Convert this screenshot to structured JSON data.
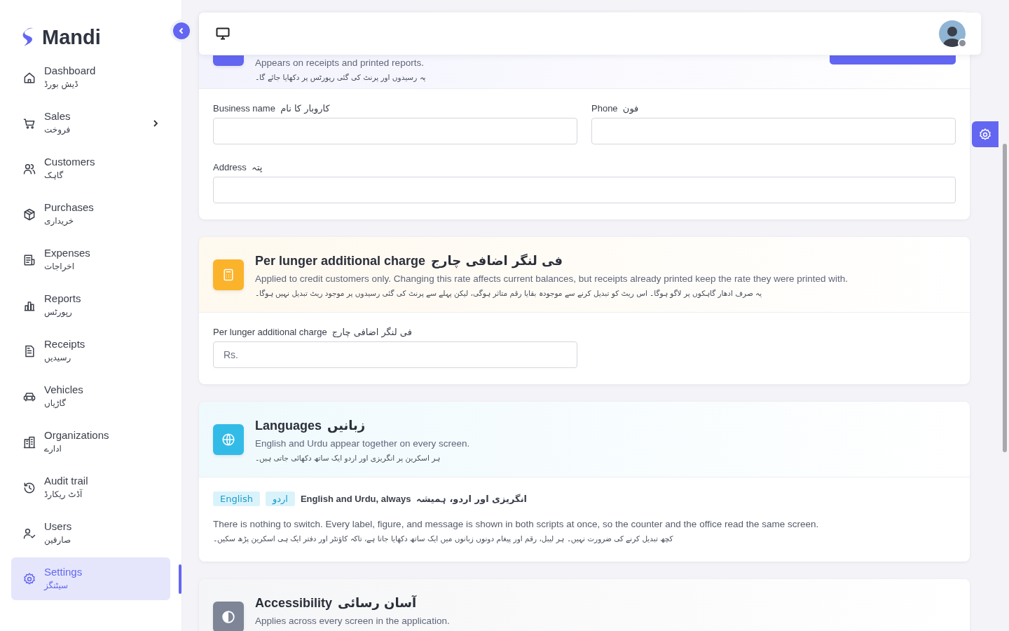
{
  "sidebar": {
    "logo": "Mandi",
    "items": [
      {
        "label": "Dashboard",
        "label_ur": "ڈیش بورڈ",
        "selected": false,
        "has_submenu": false
      },
      {
        "label": "Sales",
        "label_ur": "فروخت",
        "selected": false,
        "has_submenu": true
      },
      {
        "label": "Customers",
        "label_ur": "گاہک",
        "selected": false,
        "has_submenu": false
      },
      {
        "label": "Purchases",
        "label_ur": "خریداری",
        "selected": false,
        "has_submenu": false
      },
      {
        "label": "Expenses",
        "label_ur": "اخراجات",
        "selected": false,
        "has_submenu": false
      },
      {
        "label": "Reports",
        "label_ur": "رپورٹس",
        "selected": false,
        "has_submenu": false
      },
      {
        "label": "Receipts",
        "label_ur": "رسیدیں",
        "selected": false,
        "has_submenu": false
      },
      {
        "label": "Vehicles",
        "label_ur": "گاڑیاں",
        "selected": false,
        "has_submenu": false
      },
      {
        "label": "Organizations",
        "label_ur": "ادارے",
        "selected": false,
        "has_submenu": false
      },
      {
        "label": "Audit trail",
        "label_ur": "آڈٹ ریکارڈ",
        "selected": false,
        "has_submenu": false
      },
      {
        "label": "Users",
        "label_ur": "صارفین",
        "selected": false,
        "has_submenu": false
      },
      {
        "label": "Settings",
        "label_ur": "سیٹنگز",
        "selected": true,
        "has_submenu": false
      }
    ]
  },
  "sections": [
    {
      "kind": "business",
      "color": "#6366f1",
      "description": "Appears on receipts and printed reports.",
      "description_ur": "یہ رسیدوں اور پرنٹ کی گئی رپورٹس پر دکھایا جائے گا۔",
      "fields": {
        "business_name": {
          "label": "Business name",
          "label_ur": "کاروبار کا نام",
          "wide": false
        },
        "phone": {
          "label": "Phone",
          "label_ur": "فون",
          "wide": false
        },
        "address": {
          "label": "Address",
          "label_ur": "پتہ",
          "wide": true
        }
      }
    },
    {
      "kind": "charge",
      "color": "#fbb32b",
      "title": "Per lunger additional charge",
      "title_ur": "فی لنگر اضافی چارج",
      "description": "Applied to credit customers only. Changing this rate affects current balances, but receipts already printed keep the rate they were printed with.",
      "description_ur": "یہ صرف ادھار گاہکوں پر لاگو ہوگا۔ اس ریٹ کو تبدیل کرنے سے موجودہ بقایا رقم متاثر ہوگی، لیکن پہلے سے پرنٹ کی گئی رسیدوں پر موجود ریٹ تبدیل نہیں ہوگا۔",
      "fields": {
        "rate": {
          "label": "Per lunger additional charge",
          "label_ur": "فی لنگر اضافی چارج",
          "wide": false,
          "placeholder": "Rs."
        }
      }
    },
    {
      "kind": "languages",
      "color": "#33bbe8",
      "title": "Languages",
      "title_ur": "زبانیں",
      "description": "English and Urdu appear together on every screen.",
      "description_ur": "ہر اسکرین پر انگریزی اور اردو ایک ساتھ دکھائی جاتی ہیں۔",
      "chips": {
        "english": "English",
        "urdu": "اردو"
      },
      "note": "English and Urdu, always",
      "note_ur": "انگریزی اور اردو، ہمیشہ",
      "body": "There is nothing to switch. Every label, figure, and message is shown in both scripts at once, so the counter and the office read the same screen.",
      "body_ur": "کچھ تبدیل کرنے کی ضرورت نہیں۔ ہر لیبل، رقم اور پیغام دونوں زبانوں میں ایک ساتھ دکھایا جاتا ہے، تاکہ کاؤنٹر اور دفتر ایک ہی اسکرین پڑھ سکیں۔"
    },
    {
      "kind": "accessibility",
      "color": "#7d8597",
      "title": "Accessibility",
      "title_ur": "آسان رسائی",
      "description": "Applies across every screen in the application."
    }
  ]
}
